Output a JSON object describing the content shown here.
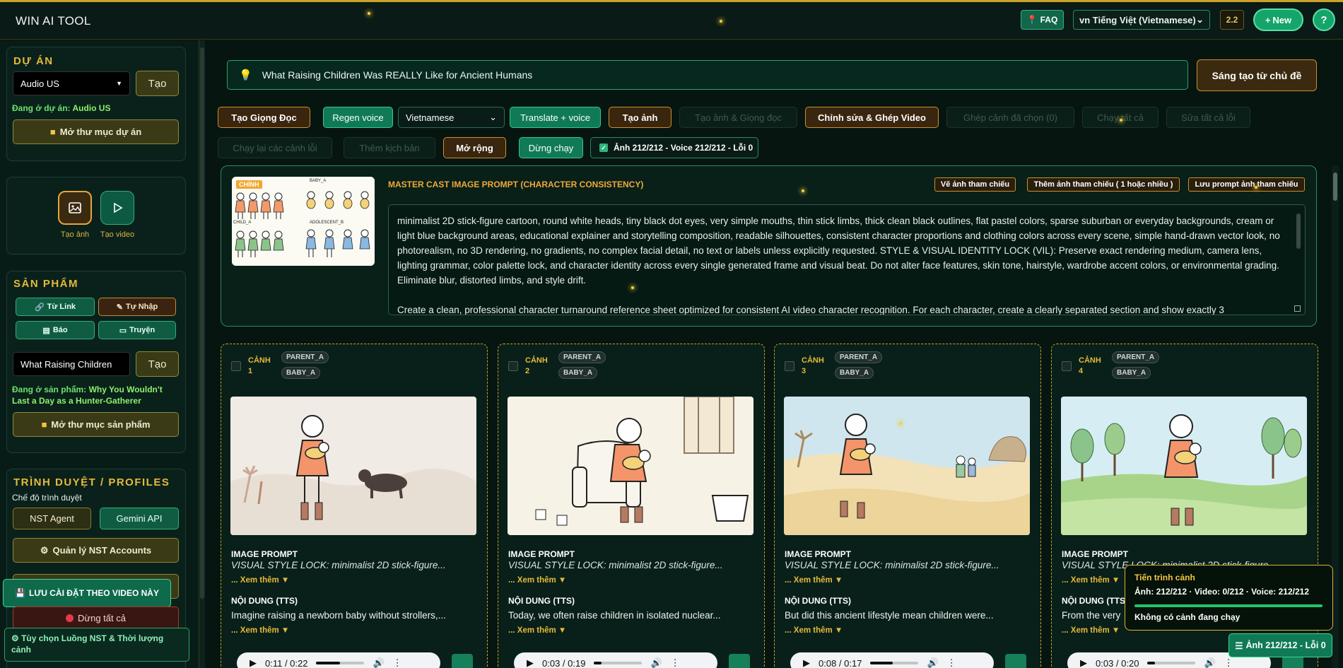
{
  "app": {
    "title": "WIN AI TOOL"
  },
  "topbar": {
    "faq": "FAQ",
    "language": "vn Tiếng Việt (Vietnamese)",
    "version": "2.2",
    "new": "New",
    "help": "?"
  },
  "sidebar": {
    "project": {
      "heading": "DỰ ÁN",
      "selected": "Audio US",
      "create": "Tạo",
      "status_prefix": "Đang ở dự án:",
      "status_value": "Audio US",
      "open_folder": "Mở thư mục dự án"
    },
    "tools": {
      "image_label": "Tạo ảnh",
      "video_label": "Tạo video"
    },
    "product": {
      "heading": "SẢN PHẨM",
      "from_link": "Từ Link",
      "manual": "Tự Nhập",
      "newspaper": "Báo",
      "story": "Truyện",
      "input_value": "What Raising Children",
      "create": "Tạo",
      "status_prefix": "Đang ở sản phẩm:",
      "status_value": "Why You Wouldn't Last a Day as a Hunter-Gatherer",
      "open_folder": "Mở thư mục sản phẩm"
    },
    "browser": {
      "heading": "TRÌNH DUYỆT / PROFILES",
      "mode_label": "Chế độ trình duyệt",
      "nst_agent": "NST Agent",
      "gemini_api": "Gemini API",
      "manage_accounts": "Quản lý NST Accounts",
      "save_settings": "LƯU CÀI ĐẶT THEO VIDEO NÀY",
      "stop_all": "Dừng tất cả",
      "nst_options": "Tùy chọn Luồng NST & Thời lượng cảnh"
    }
  },
  "topic": {
    "value": "What Raising Children Was REALLY Like for Ancient Humans",
    "create_button": "Sáng tạo từ chủ đề"
  },
  "toolbar": {
    "create_voice": "Tạo Giọng Đọc",
    "regen_voice": "Regen voice",
    "language": "Vietnamese",
    "translate_voice": "Translate + voice",
    "create_image": "Tạo ảnh",
    "create_image_voice": "Tạo ảnh & Giọng đọc",
    "edit_merge": "Chỉnh sửa & Ghép Video",
    "merge_selected": "Ghép cảnh đã chọn (0)",
    "run_all": "Chạy tất cả",
    "fix_all": "Sửa tất cả lỗi",
    "rerun_errors": "Chạy lại các cảnh lỗi",
    "add_script": "Thêm kịch bản",
    "expand": "Mở rộng",
    "stop": "Dừng chạy",
    "status": "Ảnh 212/212 - Voice 212/212 - Lỗi 0"
  },
  "master": {
    "title": "MASTER CAST IMAGE PROMPT (CHARACTER CONSISTENCY)",
    "draw_ref": "Vẽ ảnh tham chiếu",
    "add_ref": "Thêm ảnh tham chiếu ( 1 hoặc nhiều )",
    "save_prompt": "Lưu prompt ảnh tham chiếu",
    "thumb_badge": "CHÍNH",
    "thumb_label_1": "BABY_A",
    "thumb_label_2": "CHILD_A",
    "thumb_label_3": "ADOLESCENT_B",
    "prompt_p1": "minimalist 2D stick-figure cartoon, round white heads, tiny black dot eyes, very simple mouths, thin stick limbs, thick clean black outlines, flat pastel colors, sparse suburban or everyday backgrounds, cream or light blue background areas, educational explainer and storytelling composition, readable silhouettes, consistent character proportions and clothing colors across every scene, simple hand-drawn vector look, no photorealism, no 3D rendering, no gradients, no complex facial detail, no text or labels unless explicitly requested. STYLE & VISUAL IDENTITY LOCK (VIL): Preserve exact rendering medium, camera lens, lighting grammar, color palette lock, and character identity across every single generated frame and visual beat. Do not alter face features, skin tone, hairstyle, wardrobe accent colors, or environmental grading. Eliminate blur, distorted limbs, and style drift.",
    "prompt_p2": "Create a clean, professional character turnaround reference sheet optimized for consistent AI video character recognition. For each character, create a clearly separated section and show exactly 3"
  },
  "scene_labels": {
    "image_prompt": "IMAGE PROMPT",
    "content": "NỘI DUNG (TTS)",
    "see_more": "... Xem thêm ▼"
  },
  "scenes": [
    {
      "label": "CẢNH 1",
      "tags": [
        "PARENT_A",
        "BABY_A"
      ],
      "prompt": "VISUAL STYLE LOCK: minimalist 2D stick-figure...",
      "tts": "Imagine raising a newborn baby without strollers,...",
      "time": "0:11 / 0:22",
      "progress": 0.5
    },
    {
      "label": "CẢNH 2",
      "tags": [
        "PARENT_A",
        "BABY_A"
      ],
      "prompt": "VISUAL STYLE LOCK: minimalist 2D stick-figure...",
      "tts": "Today, we often raise children in isolated nuclear...",
      "time": "0:03 / 0:19",
      "progress": 0.16
    },
    {
      "label": "CẢNH 3",
      "tags": [
        "PARENT_A",
        "BABY_A"
      ],
      "prompt": "VISUAL STYLE LOCK: minimalist 2D stick-figure...",
      "tts": "But did this ancient lifestyle mean children were...",
      "time": "0:08 / 0:17",
      "progress": 0.47
    },
    {
      "label": "CẢNH 4",
      "tags": [
        "PARENT_A",
        "BABY_A"
      ],
      "prompt": "VISUAL STYLE LOCK: minimalist 2D stick-figure...",
      "tts": "From the very",
      "time": "0:03 / 0:20",
      "progress": 0.15
    }
  ],
  "progress_panel": {
    "title": "Tiến trình cảnh",
    "stats": "Ảnh: 212/212 · Video: 0/212 · Voice: 212/212",
    "fraction": 1.0,
    "note": "Không có cảnh đang chạy"
  },
  "float_status": "Ảnh 212/212 - Lỗi 0",
  "colors": {
    "accent_gold": "#e6b93a",
    "accent_green": "#15a46a",
    "background": "#071612"
  }
}
